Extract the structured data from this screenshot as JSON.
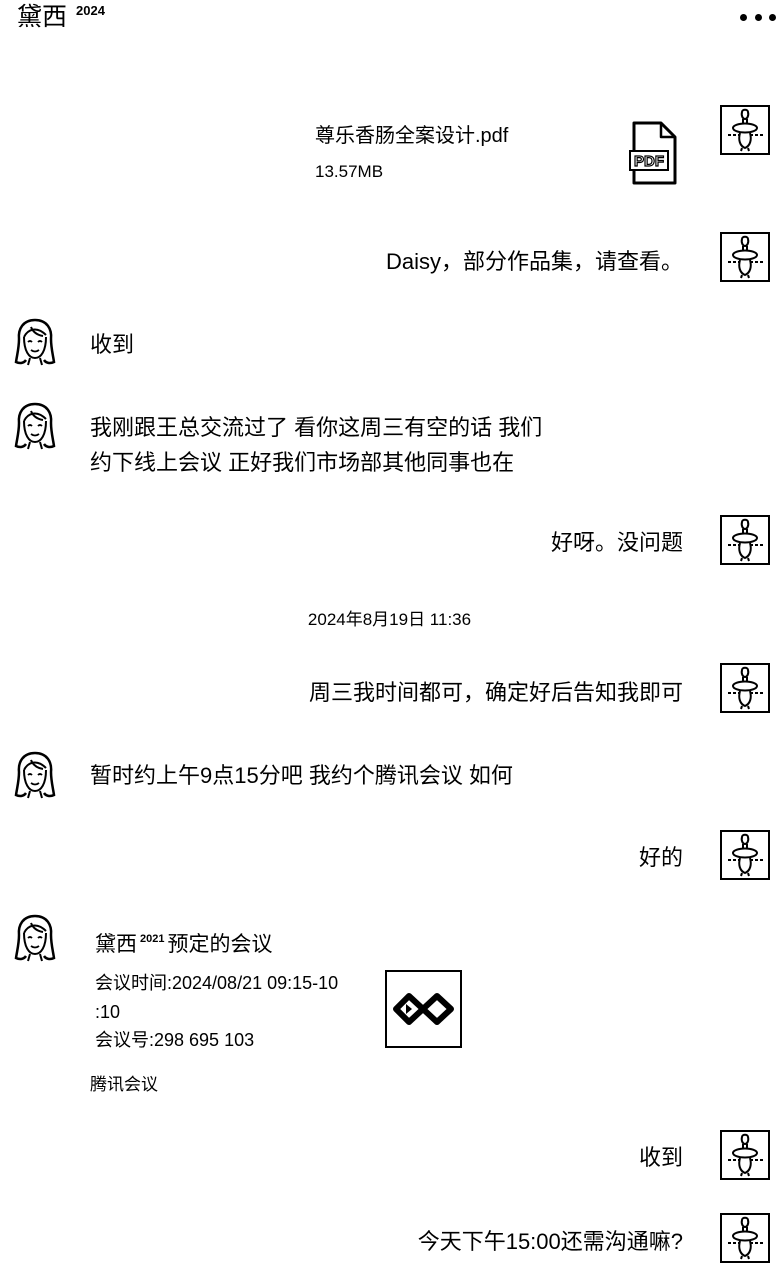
{
  "header": {
    "contact_name": "黛西",
    "contact_tag": "2024"
  },
  "icons": {
    "more": "more-icon",
    "my_avatar": "my-avatar-icon",
    "contact_avatar": "contact-avatar-icon",
    "pdf": "pdf-file-icon",
    "meeting_logo": "tencent-meeting-logo-icon"
  },
  "messages": [
    {
      "file": {
        "name": "尊乐香肠全案设计.pdf",
        "size": "13.57MB",
        "icon_label": "PDF"
      }
    },
    {
      "text": "Daisy，部分作品集，请查看。"
    },
    {
      "text": "收到"
    },
    {
      "lines": [
        "我刚跟王总交流过了 看你这周三有空的话 我们",
        "约下线上会议 正好我们市场部其他同事也在"
      ]
    },
    {
      "text": "好呀。没问题"
    },
    {
      "timestamp": "2024年8月19日 11:36"
    },
    {
      "text": "周三我时间都可，确定好后告知我即可"
    },
    {
      "text": "暂时约上午9点15分吧 我约个腾讯会议 如何"
    },
    {
      "text": "好的"
    },
    {
      "meeting": {
        "organizer": "黛西",
        "organizer_tag": "2021",
        "title_suffix": "预定的会议",
        "time_lines": [
          "会议时间:2024/08/21 09:15-10",
          ":10"
        ],
        "meeting_number": "会议号:298 695 103",
        "app_name": "腾讯会议"
      }
    },
    {
      "text": "收到"
    },
    {
      "text": "今天下午15:00还需沟通嘛?"
    }
  ]
}
